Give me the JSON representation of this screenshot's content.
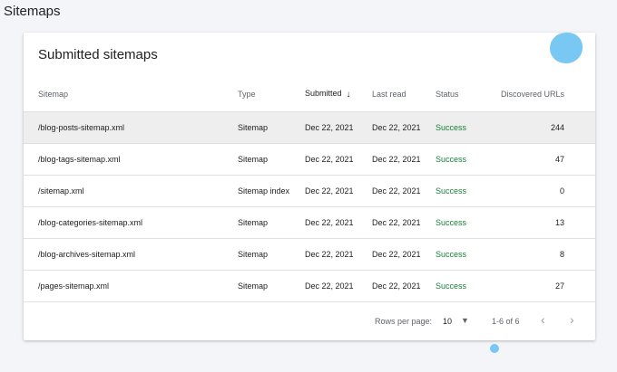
{
  "page": {
    "title": "Sitemaps"
  },
  "card": {
    "title": "Submitted sitemaps",
    "columns": {
      "sitemap": "Sitemap",
      "type": "Type",
      "submitted": "Submitted",
      "last_read": "Last read",
      "status": "Status",
      "discovered_urls": "Discovered URLs"
    },
    "rows": [
      {
        "sitemap": "/blog-posts-sitemap.xml",
        "type": "Sitemap",
        "submitted": "Dec 22, 2021",
        "last_read": "Dec 22, 2021",
        "status": "Success",
        "discovered_urls": "244"
      },
      {
        "sitemap": "/blog-tags-sitemap.xml",
        "type": "Sitemap",
        "submitted": "Dec 22, 2021",
        "last_read": "Dec 22, 2021",
        "status": "Success",
        "discovered_urls": "47"
      },
      {
        "sitemap": "/sitemap.xml",
        "type": "Sitemap index",
        "submitted": "Dec 22, 2021",
        "last_read": "Dec 22, 2021",
        "status": "Success",
        "discovered_urls": "0"
      },
      {
        "sitemap": "/blog-categories-sitemap.xml",
        "type": "Sitemap",
        "submitted": "Dec 22, 2021",
        "last_read": "Dec 22, 2021",
        "status": "Success",
        "discovered_urls": "13"
      },
      {
        "sitemap": "/blog-archives-sitemap.xml",
        "type": "Sitemap",
        "submitted": "Dec 22, 2021",
        "last_read": "Dec 22, 2021",
        "status": "Success",
        "discovered_urls": "8"
      },
      {
        "sitemap": "/pages-sitemap.xml",
        "type": "Sitemap",
        "submitted": "Dec 22, 2021",
        "last_read": "Dec 22, 2021",
        "status": "Success",
        "discovered_urls": "27"
      }
    ],
    "footer": {
      "rows_per_page_label": "Rows per page:",
      "rows_per_page_value": "10",
      "range": "1-6 of 6"
    }
  },
  "icons": {
    "sort": "arrow-down-icon",
    "dropdown": "caret-down-icon",
    "prev": "chevron-left-icon",
    "next": "chevron-right-icon"
  },
  "colors": {
    "success": "#188038",
    "highlight_row": "#eeeeee",
    "background": "#f4f5f9",
    "blob": "#79c7f3"
  }
}
